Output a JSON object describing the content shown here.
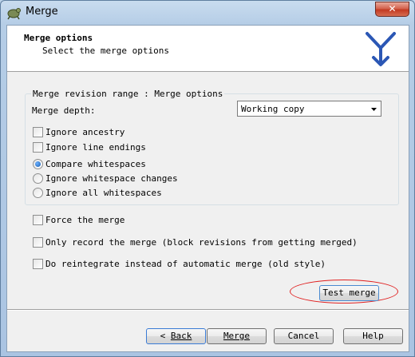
{
  "window": {
    "title": "Merge",
    "close_label": "✕"
  },
  "header": {
    "title": "Merge options",
    "subtitle": "Select the merge options"
  },
  "group": {
    "legend": "Merge revision range : Merge options",
    "depth_label": "Merge depth:",
    "depth_value": "Working copy",
    "ignore_ancestry": "Ignore ancestry",
    "ignore_line_endings": "Ignore line endings",
    "whitespace_options": [
      {
        "label": "Compare whitespaces",
        "checked": true
      },
      {
        "label": "Ignore whitespace changes",
        "checked": false
      },
      {
        "label": "Ignore all whitespaces",
        "checked": false
      }
    ]
  },
  "options": {
    "force_merge": "Force the merge",
    "record_only": "Only record the merge (block revisions from getting merged)",
    "reintegrate": "Do reintegrate instead of automatic merge (old style)"
  },
  "buttons": {
    "test_merge": "Test merge",
    "back_arrow": "<",
    "back": "Back",
    "merge": "Merge",
    "cancel": "Cancel",
    "help": "Help"
  }
}
